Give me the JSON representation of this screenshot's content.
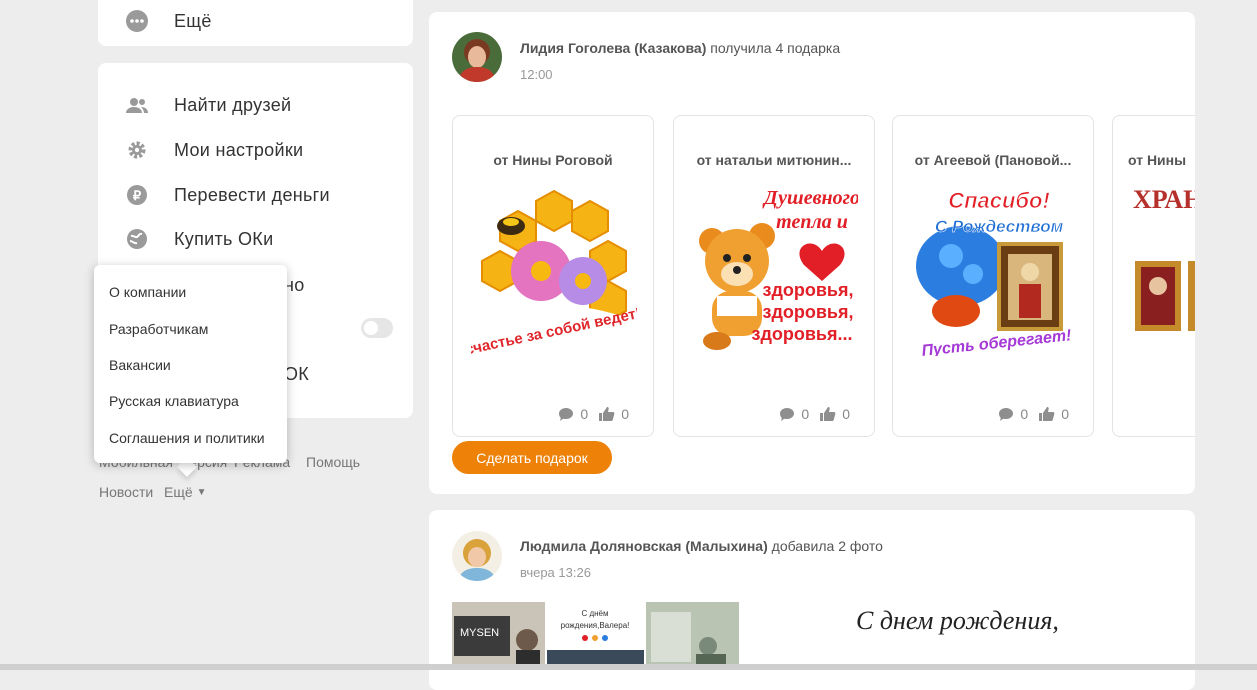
{
  "sidebar": {
    "more_label": "Ещё",
    "items": [
      {
        "label": "Найти друзей",
        "icon": "friends-icon"
      },
      {
        "label": "Мои настройки",
        "icon": "gear-icon"
      },
      {
        "label": "Перевести деньги",
        "icon": "ruble-icon"
      },
      {
        "label": "Купить ОКи",
        "icon": "globe-coin-icon"
      },
      {
        "label": "но",
        "icon": ""
      },
      {
        "label": "ОК",
        "icon": ""
      }
    ]
  },
  "dropdown": {
    "items": [
      "О компании",
      "Разработчикам",
      "Вакансии",
      "Русская клавиатура",
      "Соглашения и политики"
    ]
  },
  "footer": {
    "links_row1": [
      "Мобильная",
      "версия",
      "Реклама",
      "Помощь"
    ],
    "news": "Новости",
    "more": "Ещё"
  },
  "post1": {
    "author": "Лидия Гоголева (Казакова)",
    "action": "получила 4 подарка",
    "time": "12:00",
    "gifts": [
      {
        "from": "от Нины Роговой",
        "comments": "0",
        "likes": "0",
        "text": "счастье за собой ведет!"
      },
      {
        "from": "от натальи митюнин...",
        "comments": "0",
        "likes": "0",
        "text": "Душевного тепла и здоровья, здоровья, здоровья..."
      },
      {
        "from": "от Агеевой (Пановой...",
        "comments": "0",
        "likes": "0",
        "text": "Спасибо! С Рождеством Пусть оберегает!"
      },
      {
        "from": "от Нины",
        "text": "ХРАНИ ВАШУ"
      }
    ],
    "button": "Сделать подарок"
  },
  "post2": {
    "author": "Людмила Доляновская (Малыхина)",
    "action": "добавила 2 фото",
    "time": "вчера 13:26",
    "photo_text": "С днём рождения, Валера!",
    "photo_caption": "С днем рождения,",
    "photo_sign": "MYSEN"
  },
  "colors": {
    "accent": "#ee8208",
    "background": "#ededed"
  }
}
